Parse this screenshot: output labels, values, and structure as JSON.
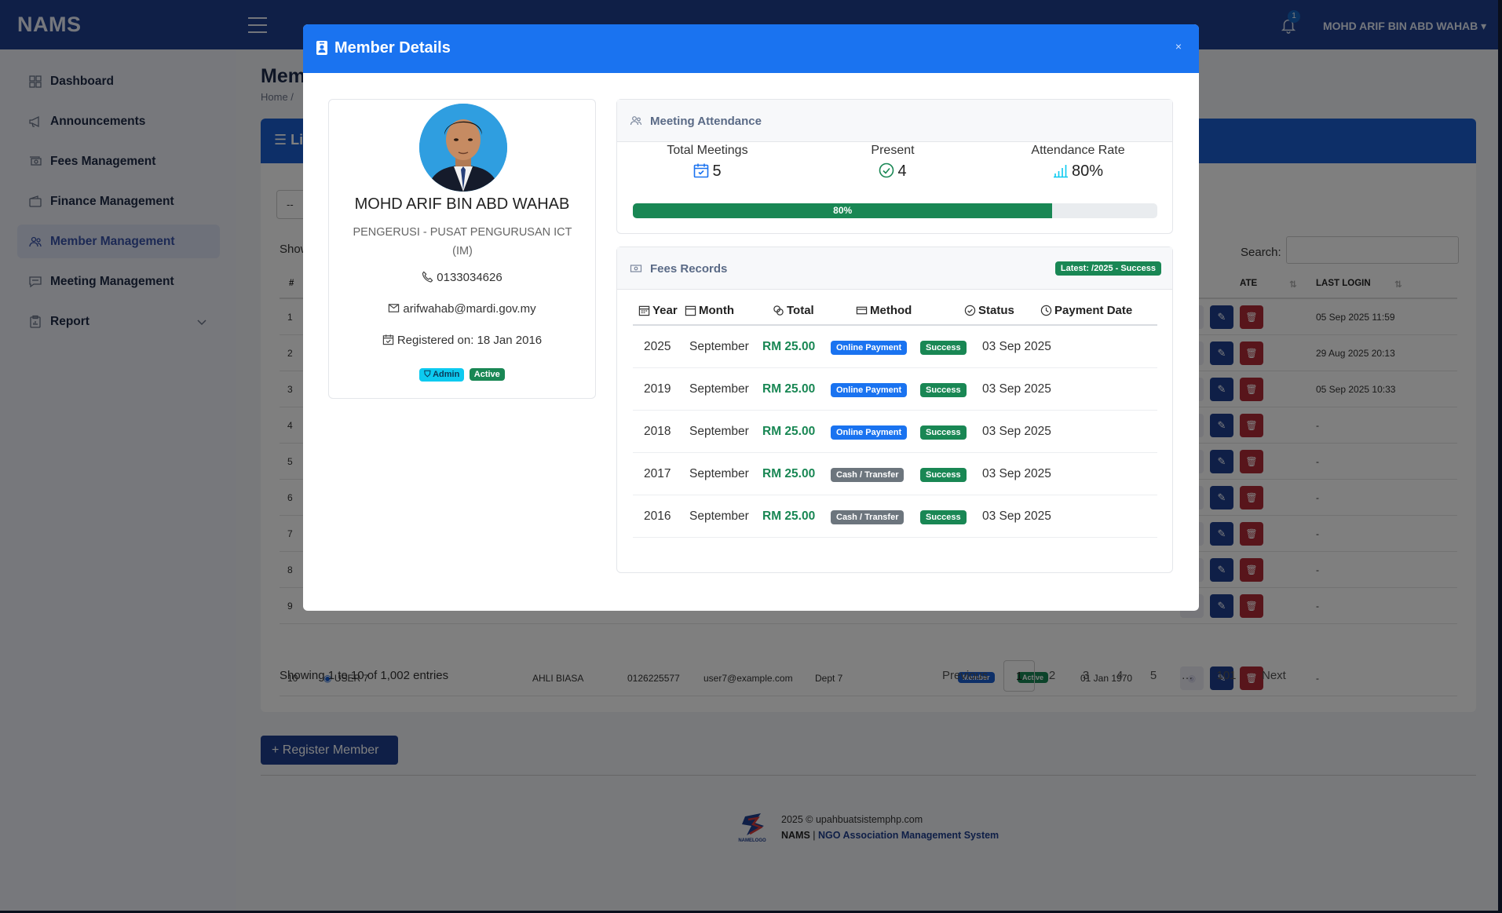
{
  "app": {
    "brand": "NAMS",
    "user_name": "MOHD ARIF BIN ABD WAHAB",
    "notification_count": "1"
  },
  "sidebar": {
    "items": [
      {
        "label": "Dashboard"
      },
      {
        "label": "Announcements"
      },
      {
        "label": "Fees Management"
      },
      {
        "label": "Finance Management"
      },
      {
        "label": "Member Management"
      },
      {
        "label": "Meeting Management"
      },
      {
        "label": "Report"
      }
    ]
  },
  "page": {
    "title": "Mem",
    "breadcrumb": "Home /",
    "card_title": "Li",
    "length_select": "--",
    "show_label": "Show",
    "search_label": "Search:"
  },
  "table": {
    "headers": {
      "num": "#",
      "date": "ATE",
      "last_login": "LAST LOGIN"
    },
    "rows": [
      {
        "num": "1",
        "last_login": "05 Sep 2025 11:59"
      },
      {
        "num": "2",
        "last_login": "29 Aug 2025 20:13"
      },
      {
        "num": "3",
        "last_login": "05 Sep 2025 10:33"
      },
      {
        "num": "4",
        "last_login": "-"
      },
      {
        "num": "5",
        "last_login": "-"
      },
      {
        "num": "6",
        "last_login": "-"
      },
      {
        "num": "7",
        "last_login": "-"
      },
      {
        "num": "8",
        "last_login": "-"
      },
      {
        "num": "9",
        "last_login": "-"
      }
    ],
    "row10": {
      "num": "10",
      "name": "USER 7",
      "role": "AHLI BIASA",
      "phone": "0126225577",
      "email": "user7@example.com",
      "dept": "Dept 7",
      "type": "Member",
      "status": "Active",
      "date": "01 Jan 1970",
      "last_login": "-"
    },
    "info": "Showing 1 to 10 of 1,002 entries",
    "pager": {
      "prev": "Previous",
      "pages": [
        "1",
        "2",
        "3",
        "4",
        "5",
        "…",
        "101"
      ],
      "next": "Next"
    }
  },
  "register_button": "+ Register Member",
  "footer": {
    "line1": "2025 © upahbuatsistemphp.com",
    "name": "NAMS",
    "sep": " | ",
    "full": "NGO Association Management System",
    "logo_text": "NAMELOGO"
  },
  "modal": {
    "title": "Member Details",
    "close": "×",
    "profile": {
      "name": "MOHD ARIF BIN ABD WAHAB",
      "role": "PENGERUSI - PUSAT PENGURUSAN ICT (IM)",
      "phone": "0133034626",
      "email": "arifwahab@mardi.gov.my",
      "registered": "Registered on: 18 Jan 2016",
      "badge_admin": "Admin",
      "badge_active": "Active"
    },
    "attendance": {
      "title": "Meeting Attendance",
      "total_label": "Total Meetings",
      "total_value": "5",
      "present_label": "Present",
      "present_value": "4",
      "rate_label": "Attendance Rate",
      "rate_value": "80%",
      "bar_percent": 80,
      "bar_text": "80%"
    },
    "fees": {
      "title": "Fees Records",
      "latest": "Latest: /2025 - Success",
      "headers": {
        "year": "Year",
        "month": "Month",
        "total": "Total",
        "method": "Method",
        "status": "Status",
        "date": "Payment Date"
      },
      "rows": [
        {
          "year": "2025",
          "month": "September",
          "total": "RM 25.00",
          "method": "Online Payment",
          "status": "Success",
          "date": "03 Sep 2025"
        },
        {
          "year": "2019",
          "month": "September",
          "total": "RM 25.00",
          "method": "Online Payment",
          "status": "Success",
          "date": "03 Sep 2025"
        },
        {
          "year": "2018",
          "month": "September",
          "total": "RM 25.00",
          "method": "Online Payment",
          "status": "Success",
          "date": "03 Sep 2025"
        },
        {
          "year": "2017",
          "month": "September",
          "total": "RM 25.00",
          "method": "Cash / Transfer",
          "status": "Success",
          "date": "03 Sep 2025"
        },
        {
          "year": "2016",
          "month": "September",
          "total": "RM 25.00",
          "method": "Cash / Transfer",
          "status": "Success",
          "date": "03 Sep 2025"
        }
      ]
    }
  },
  "colors": {
    "primary": "#1a73f0",
    "navy": "#1e3f8f",
    "success": "#198754",
    "danger": "#b02a37",
    "secondary": "#6c757d",
    "info": "#0dcaf0"
  }
}
